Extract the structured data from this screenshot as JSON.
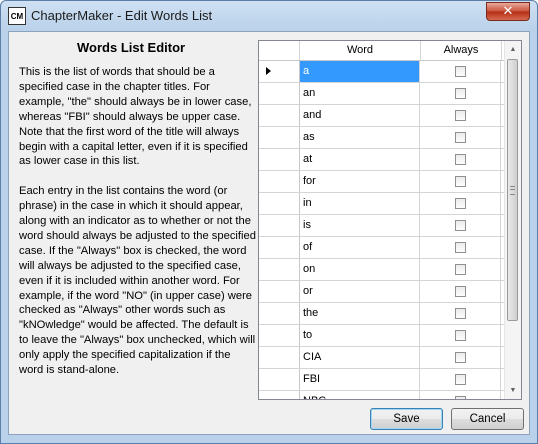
{
  "window": {
    "title": "ChapterMaker - Edit Words List",
    "app_icon_text": "CM",
    "close_label": "✕"
  },
  "editor": {
    "heading": "Words List Editor",
    "paragraphs": [
      "This is the list of words that should be a specified case in the chapter titles.  For example, \"the\" should always be in lower case, whereas \"FBI\" should always be upper case.  Note that the first word of the title will always begin with a capital letter, even if it is specified as lower case in this list.",
      "Each entry in the list contains the word (or phrase) in the case in which it should appear, along with an indicator as to whether or not the word should always be adjusted to the specified case.  If the \"Always\" box is checked, the word will always be adjusted to the specified case, even if it is included within another word.  For example, if the word \"NO\" (in upper case) were checked as \"Always\" other words such as \"kNOwledge\" would be affected.  The default is to leave the \"Always\" box unchecked, which will only apply the specified capitalization if the word is stand-alone."
    ]
  },
  "grid": {
    "columns": [
      "Word",
      "Always"
    ],
    "rows": [
      {
        "word": "a",
        "always": false,
        "selected": true
      },
      {
        "word": "an",
        "always": false
      },
      {
        "word": "and",
        "always": false
      },
      {
        "word": "as",
        "always": false
      },
      {
        "word": "at",
        "always": false
      },
      {
        "word": "for",
        "always": false
      },
      {
        "word": "in",
        "always": false
      },
      {
        "word": "is",
        "always": false
      },
      {
        "word": "of",
        "always": false
      },
      {
        "word": "on",
        "always": false
      },
      {
        "word": "or",
        "always": false
      },
      {
        "word": "the",
        "always": false
      },
      {
        "word": "to",
        "always": false
      },
      {
        "word": "CIA",
        "always": false
      },
      {
        "word": "FBI",
        "always": false
      },
      {
        "word": "NBC",
        "always": false
      }
    ]
  },
  "buttons": {
    "save": "Save",
    "cancel": "Cancel"
  }
}
